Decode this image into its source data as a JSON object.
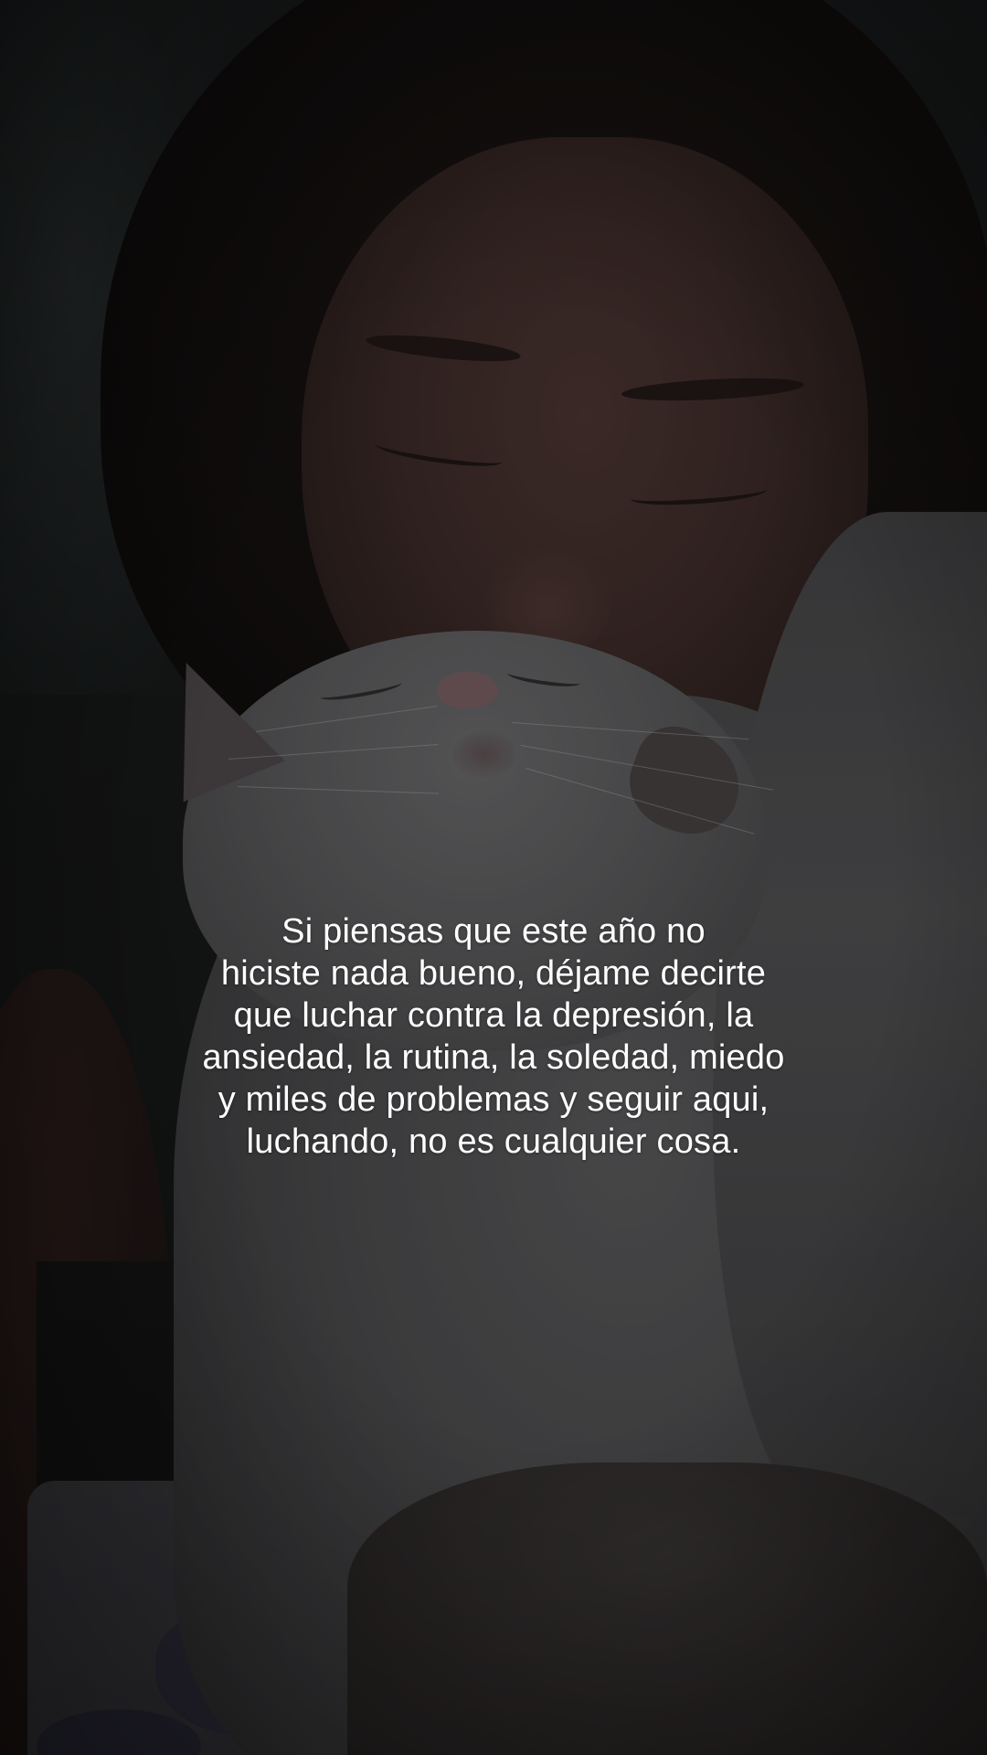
{
  "caption": {
    "lines": [
      "Si piensas que este año no",
      "hiciste nada bueno, déjame decirte",
      "que luchar contra la depresión, la",
      "ansiedad, la rutina, la soledad, miedo",
      "y miles de problemas y seguir aqui,",
      "luchando, no es cualquier cosa."
    ],
    "color": "#ffffff"
  },
  "photo": {
    "subject": "sleeping-person-with-white-cat"
  }
}
